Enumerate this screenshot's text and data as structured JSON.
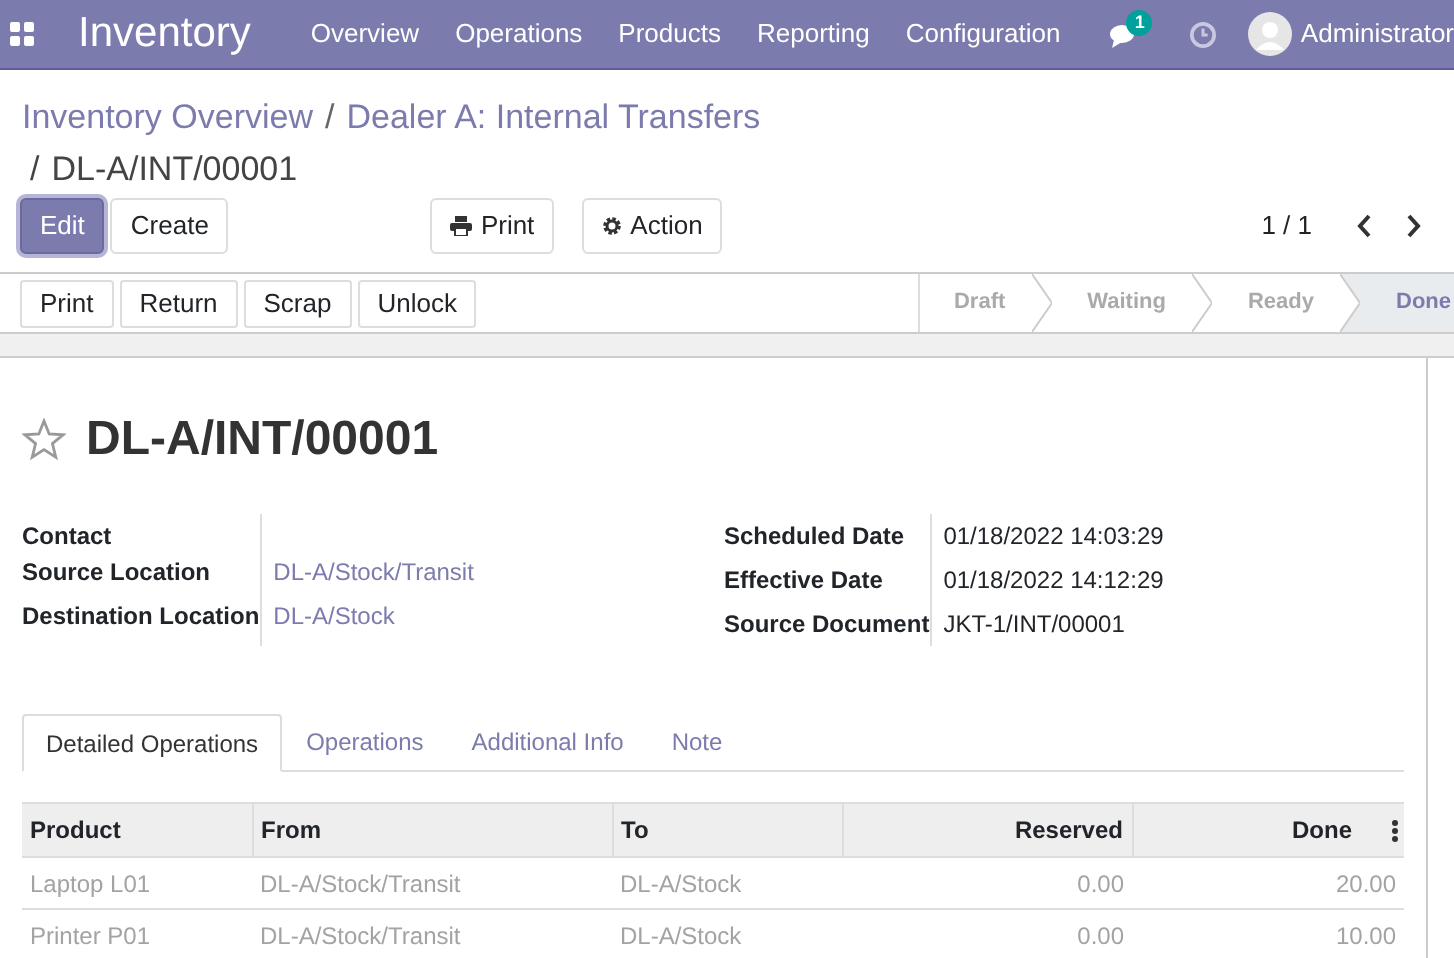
{
  "navbar": {
    "app_name": "Inventory",
    "menu": [
      "Overview",
      "Operations",
      "Products",
      "Reporting",
      "Configuration"
    ],
    "messages_badge": "1",
    "user": "Administrator"
  },
  "breadcrumb": {
    "separator": "/",
    "links": [
      "Inventory Overview",
      "Dealer A: Internal Transfers"
    ],
    "current": "DL-A/INT/00001"
  },
  "control_buttons": [
    {
      "label": "Edit",
      "kind": "primary"
    },
    {
      "label": "Create",
      "kind": "default"
    },
    {
      "label": "Print",
      "kind": "print"
    },
    {
      "label": "Action",
      "kind": "action"
    }
  ],
  "pager": "1 / 1",
  "header_buttons": [
    "Print",
    "Return",
    "Scrap",
    "Unlock"
  ],
  "statusbar": [
    {
      "label": "Draft",
      "selected": false
    },
    {
      "label": "Waiting",
      "selected": false
    },
    {
      "label": "Ready",
      "selected": false
    },
    {
      "label": "Done",
      "selected": true
    }
  ],
  "record": {
    "title": "DL-A/INT/00001",
    "starred": false,
    "left_fields": [
      {
        "label": "Contact"
      },
      {
        "label": "Source Location",
        "value": "DL-A/Stock/Transit",
        "kind": "link"
      },
      {
        "label": "Destination Location",
        "value": "DL-A/Stock",
        "kind": "link"
      }
    ],
    "right_fields": [
      {
        "label": "Scheduled Date",
        "value": "01/18/2022 14:03:29"
      },
      {
        "label": "Effective Date",
        "value": "01/18/2022 14:12:29"
      },
      {
        "label": "Source Document",
        "value": "JKT-1/INT/00001"
      }
    ]
  },
  "tabs": [
    {
      "label": "Detailed Operations",
      "selected": true
    },
    {
      "label": "Operations",
      "selected": false
    },
    {
      "label": "Additional Info",
      "selected": false
    },
    {
      "label": "Note",
      "selected": false
    }
  ],
  "table": {
    "columns": [
      "Product",
      "From",
      "To",
      "Reserved",
      "Done"
    ],
    "rows": [
      [
        "Laptop L01",
        "DL-A/Stock/Transit",
        "DL-A/Stock",
        "0.00",
        "20.00"
      ],
      [
        "Printer P01",
        "DL-A/Stock/Transit",
        "DL-A/Stock",
        "0.00",
        "10.00"
      ]
    ]
  }
}
